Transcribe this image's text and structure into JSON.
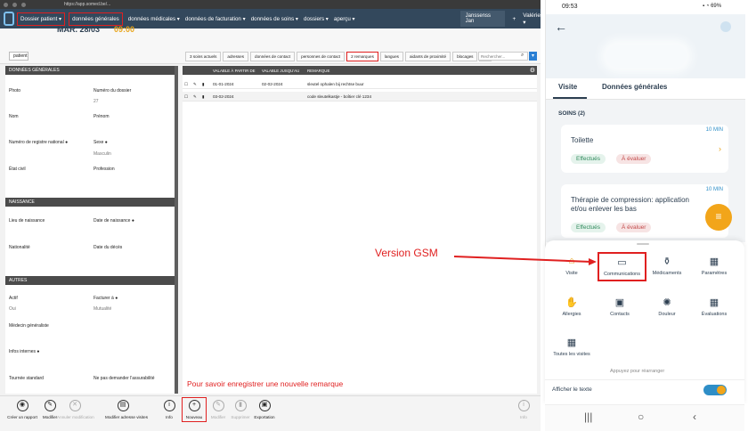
{
  "browser": {
    "url": "https://app.somed.be/..."
  },
  "nav": {
    "items": [
      "Dossier patient ▾",
      "données générales",
      "données médicales ▾",
      "données de facturation ▾",
      "données de soins ▾",
      "dossiers ▾",
      "aperçu ▾"
    ],
    "user": "Janssenss Jan",
    "right_plus": "+",
    "right_user": "Valérie ▾"
  },
  "patient_pill": "patient",
  "tabs": [
    "3 soins actuels",
    "adresses",
    "données de contact",
    "personnes de contact",
    "2 remarques",
    "langues",
    "aidants de proximité",
    "blocages",
    "..."
  ],
  "search_placeholder": "Rechercher...",
  "left": {
    "sections": [
      "DONNÉES GÉNÉRALES",
      "NAISSANCE",
      "AUTRES"
    ],
    "fields": {
      "photo": "Photo",
      "num_dossier": "Numéro du dossier",
      "num_dossier_val": "27",
      "nom": "Nom",
      "prenom": "Prénom",
      "nrn": "Numéro de registre national",
      "sexe": "Sexe",
      "sexe_val": "Masculin",
      "etat_civil": "État civil",
      "profession": "Profession",
      "lieu_naissance": "Lieu de naissance",
      "date_naissance": "Date de naissance",
      "nationalite": "Nationalité",
      "date_deces": "Date du décès",
      "actif": "Actif",
      "actif_val": "Oui",
      "facturer": "Facturer à",
      "facturer_val": "Mutualité",
      "medecin": "Médecin généraliste",
      "infos": "Infos internes",
      "tournee": "Tournée standard",
      "assurabilite": "Ne pas demander l'assurabilité"
    }
  },
  "table": {
    "headers": [
      "VALABLE À PARTIR DE",
      "VALABLE JUSQU'AU",
      "REMARQUE"
    ],
    "rows": [
      {
        "from": "01-01-2024",
        "to": "02-02-2024",
        "remark": "sleutel ophalen bij rechtse buur"
      },
      {
        "from": "03-02-2024",
        "to": "",
        "remark": "code sleutelkastje - boîtier clé 1234"
      }
    ]
  },
  "bottombar": {
    "buttons": [
      "Créer un rapport",
      "Modifier",
      "Annuler modification",
      "Modifier adresse visites",
      "Info",
      "Nouveau",
      "Modifier",
      "Supprimer",
      "Exportation",
      "Info"
    ]
  },
  "annotations": {
    "bottom_note": "Pour savoir enregistrer une nouvelle remarque",
    "gsm": "Version GSM"
  },
  "phone": {
    "time": "09:53",
    "battery": "69%",
    "date": "MAR. 28/03",
    "visit_time": "09:00",
    "tabs": [
      "Visite",
      "Données générales"
    ],
    "soins_title": "SOINS (2)",
    "cards": [
      {
        "minutes": "10 MIN",
        "title": "Toilette",
        "chips": [
          "Effectués",
          "À évaluer"
        ]
      },
      {
        "minutes": "10 MIN",
        "title": "Thérapie de compression: application et/ou enlever les bas",
        "chips": [
          "Effectués",
          "À évaluer"
        ]
      }
    ],
    "menu": [
      "Visite",
      "Communications",
      "Médicaments",
      "Paramètres",
      "Allergies",
      "Contacts",
      "Douleur",
      "Évaluations",
      "Toutes les visites"
    ],
    "hint": "Appuyez pour réarranger",
    "toggle_label": "Afficher le texte",
    "colors": {
      "accent": "#e8a317",
      "primary": "#2c3e50",
      "link": "#2e8ec7",
      "annotation": "#e02020"
    }
  }
}
